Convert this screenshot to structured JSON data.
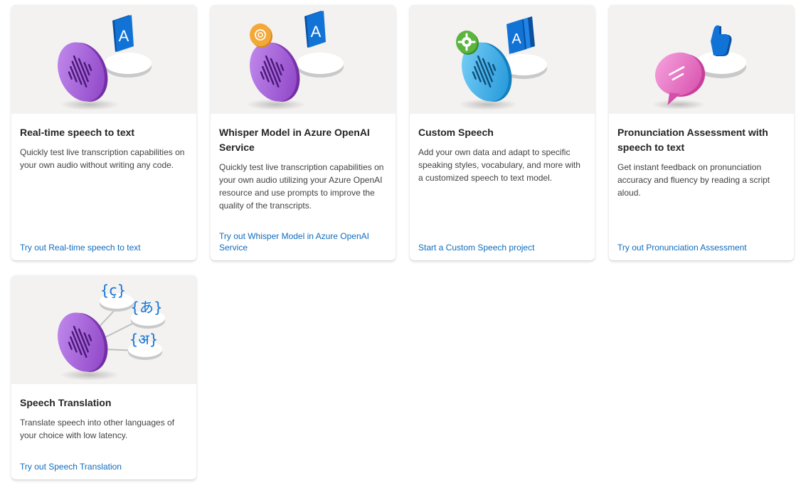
{
  "cards": [
    {
      "title": "Real-time speech to text",
      "description": "Quickly test live transcription capabilities on your own audio without writing any code.",
      "link": "Try out Real-time speech to text"
    },
    {
      "title": "Whisper Model in Azure OpenAI Service",
      "description": "Quickly test live transcription capabilities on your own audio utilizing your Azure OpenAI resource and use prompts to improve the quality of the transcripts.",
      "link": "Try out Whisper Model in Azure OpenAI Service"
    },
    {
      "title": "Custom Speech",
      "description": "Add your own data and adapt to specific speaking styles, vocabulary, and more with a customized speech to text model.",
      "link": "Start a Custom Speech project"
    },
    {
      "title": "Pronunciation Assessment with speech to text",
      "description": "Get instant feedback on pronunciation accuracy and fluency by reading a script aloud.",
      "link": "Try out Pronunciation Assessment"
    },
    {
      "title": "Speech Translation",
      "description": "Translate speech into other languages of your choice with low latency.",
      "link": "Try out Speech Translation"
    }
  ],
  "illustrations": {
    "letter_glyph": "A",
    "translation_glyphs": [
      "{ç}",
      "{あ}",
      "{अ}"
    ]
  },
  "colors": {
    "link": "#0f6cbd",
    "purple_disc": "#a764d6",
    "blue_disc": "#3ab4ec",
    "pink_disc": "#ec6cc6",
    "tile_blue": "#1273d6",
    "gear_green": "#5cb53e",
    "badge_orange": "#f3a93a",
    "hero_bg": "#f3f2f1"
  }
}
